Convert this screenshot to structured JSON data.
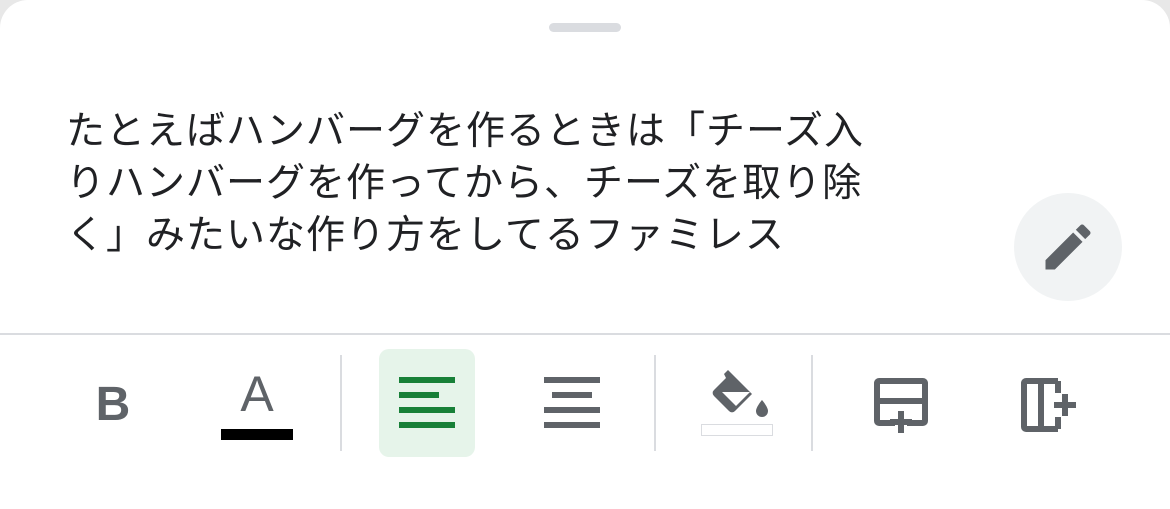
{
  "cell_text": {
    "line1": "たとえばハンバーグを作るときは「チーズ入",
    "line2": "りハンバーグを作ってから、チーズを取り除",
    "line3": "く」みたいな作り方をしてるファミレス"
  },
  "colors": {
    "accent_green": "#188038",
    "active_bg": "#e6f4ea",
    "icon_gray": "#5f6368",
    "text_color_swatch": "#000000",
    "fill_color_swatch": "#ffffff"
  },
  "toolbar": {
    "bold_glyph": "B",
    "text_color_glyph": "A",
    "items": [
      {
        "icon": "bold-icon"
      },
      {
        "icon": "text-color-icon"
      },
      {
        "icon": "align-left-icon",
        "selected": true
      },
      {
        "icon": "align-center-icon"
      },
      {
        "icon": "fill-color-icon"
      },
      {
        "icon": "insert-row-icon"
      },
      {
        "icon": "insert-column-icon"
      }
    ]
  },
  "edit": {
    "icon": "pencil-icon"
  }
}
